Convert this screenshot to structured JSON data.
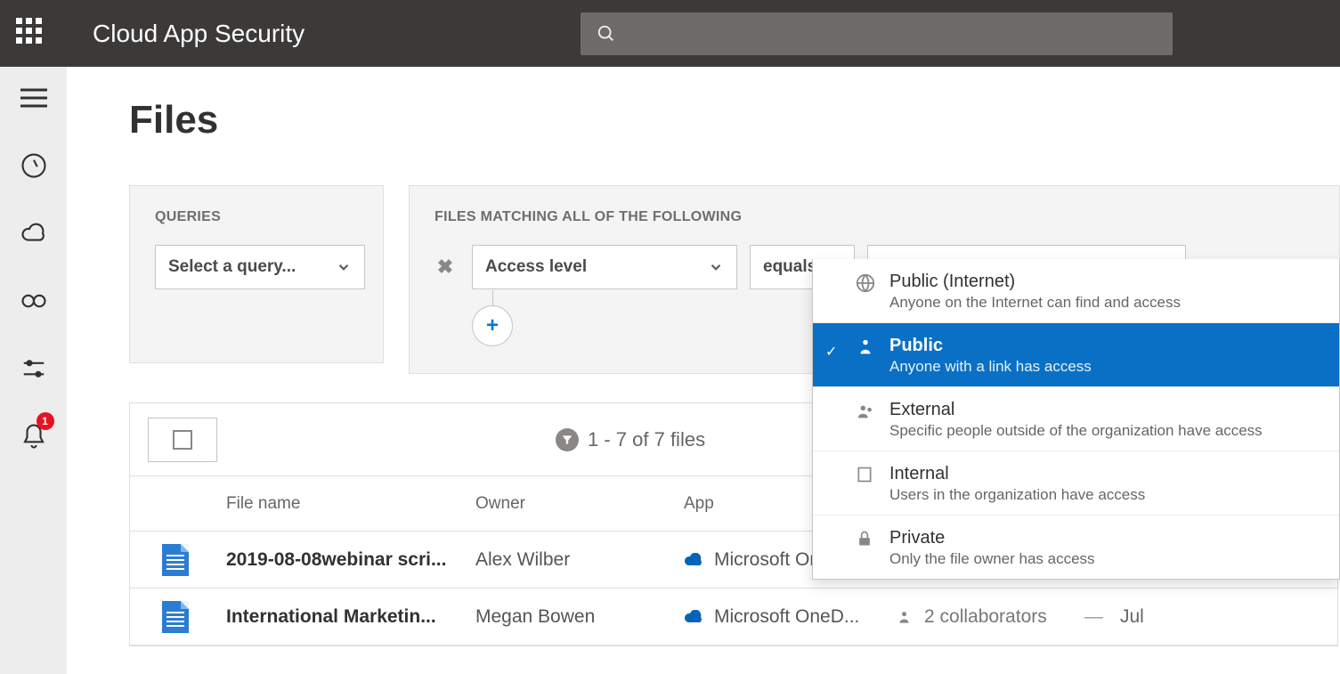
{
  "app_title": "Cloud App Security",
  "search_placeholder": "",
  "bell_count": "1",
  "page_title": "Files",
  "queries": {
    "label": "QUERIES",
    "select_placeholder": "Select a query..."
  },
  "matching": {
    "label": "FILES MATCHING ALL OF THE FOLLOWING",
    "filter_field": "Access level",
    "filter_op": "equals",
    "filter_value": "Public"
  },
  "access_options": [
    {
      "title": "Public (Internet)",
      "desc": "Anyone on the Internet can find and access",
      "selected": false,
      "icon": "globe"
    },
    {
      "title": "Public",
      "desc": "Anyone with a link has access",
      "selected": true,
      "icon": "share"
    },
    {
      "title": "External",
      "desc": "Specific people outside of the organization have access",
      "selected": false,
      "icon": "people"
    },
    {
      "title": "Internal",
      "desc": "Users in the organization have access",
      "selected": false,
      "icon": "building"
    },
    {
      "title": "Private",
      "desc": "Only the file owner has access",
      "selected": false,
      "icon": "lock"
    }
  ],
  "table": {
    "count_text": "1 - 7 of 7 files",
    "headers": {
      "file": "File name",
      "owner": "Owner",
      "app": "App"
    },
    "rows": [
      {
        "file": "2019-08-08webinar scri...",
        "owner": "Alex Wilber",
        "app": "Microsoft OneD...",
        "collab": "",
        "date": ""
      },
      {
        "file": "International Marketin...",
        "owner": "Megan Bowen",
        "app": "Microsoft OneD...",
        "collab": "2 collaborators",
        "date": "Jul"
      }
    ]
  }
}
